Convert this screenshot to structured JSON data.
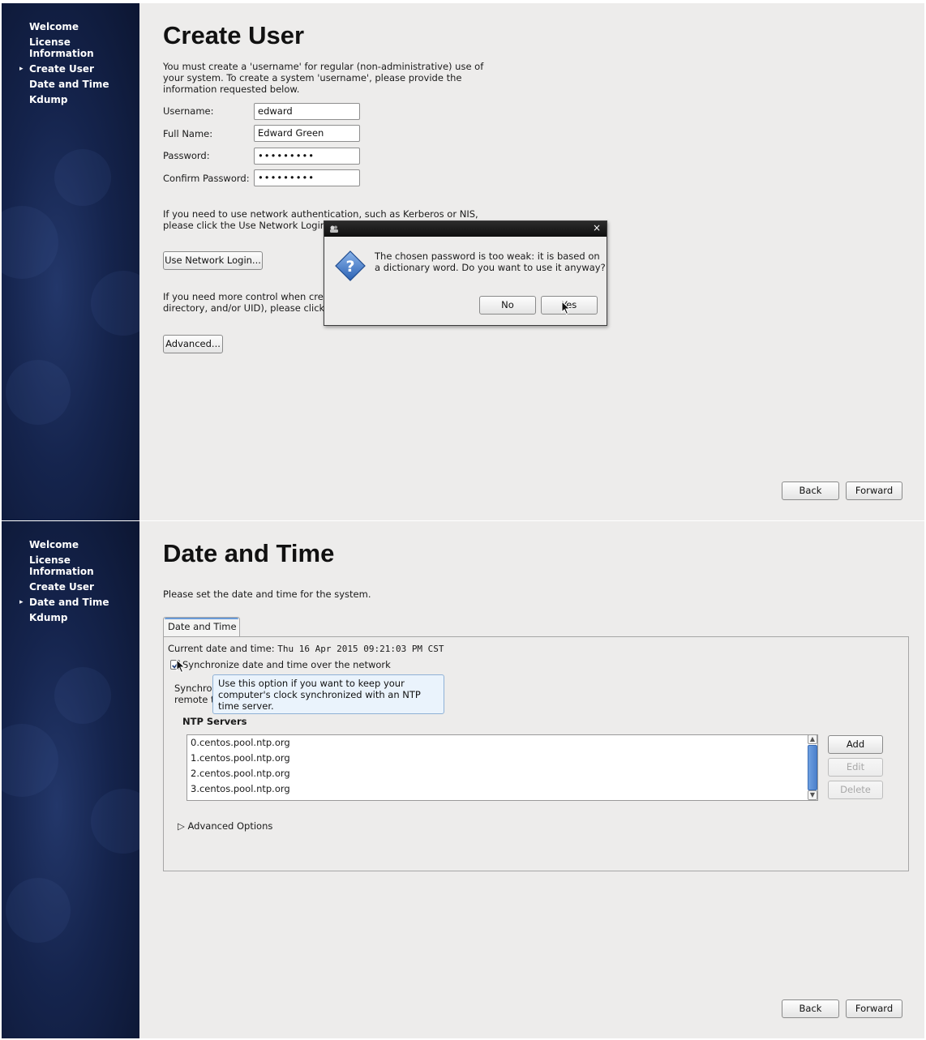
{
  "nav_items": [
    "Welcome",
    "License Information",
    "Create User",
    "Date and Time",
    "Kdump"
  ],
  "create_user": {
    "title": "Create User",
    "intro": "You must create a 'username' for regular (non-administrative) use of your system.  To create a system 'username', please provide the information requested below.",
    "fields": {
      "username": {
        "label": "Username:",
        "value": "edward"
      },
      "full_name": {
        "label": "Full Name:",
        "value": "Edward Green"
      },
      "password": {
        "label": "Password:",
        "value": "•••••••••"
      },
      "confirm": {
        "label": "Confirm Password:",
        "value": "•••••••••"
      }
    },
    "network_text_1": "If you need to use network authentication, such as Kerberos or NIS,",
    "network_text_2": "please click the Use Network Login button.",
    "network_button": "Use Network Login...",
    "control_text_1": "If you need more control when creating the user (specifying home",
    "control_text_2": "directory, and/or UID), please click the Advanced button.",
    "advanced_button": "Advanced...",
    "back_button": "Back",
    "forward_button": "Forward"
  },
  "dialog": {
    "close": "×",
    "message": "The chosen password is too weak: it is based on a dictionary word. Do you want to use it anyway?",
    "no_button": "No",
    "yes_button": "Yes"
  },
  "date_time": {
    "title": "Date and Time",
    "intro": "Please set the date and time for the system.",
    "tab_label": "Date and Time",
    "current_label": "Current date and time:",
    "current_value": "Thu 16 Apr 2015 09:21:03 PM CST",
    "sync_checkbox_label": "Synchronize date and time over the network",
    "sync_checked": true,
    "sync_text_line1": "Synchronize your computer's clock with a",
    "sync_text_line2": "remote time server using the Network Time Protocol:",
    "tooltip": "Use this option if you want to keep your computer's clock synchronized with an NTP time server.",
    "ntp_heading": "NTP Servers",
    "ntp_servers": [
      "0.centos.pool.ntp.org",
      "1.centos.pool.ntp.org",
      "2.centos.pool.ntp.org",
      "3.centos.pool.ntp.org"
    ],
    "add_button": "Add",
    "edit_button": "Edit",
    "delete_button": "Delete",
    "advanced_options": "Advanced Options",
    "back_button": "Back",
    "forward_button": "Forward"
  },
  "colors": {
    "sidebar": "#15244d",
    "background": "#edeceb",
    "accent": "#4c81cc"
  }
}
